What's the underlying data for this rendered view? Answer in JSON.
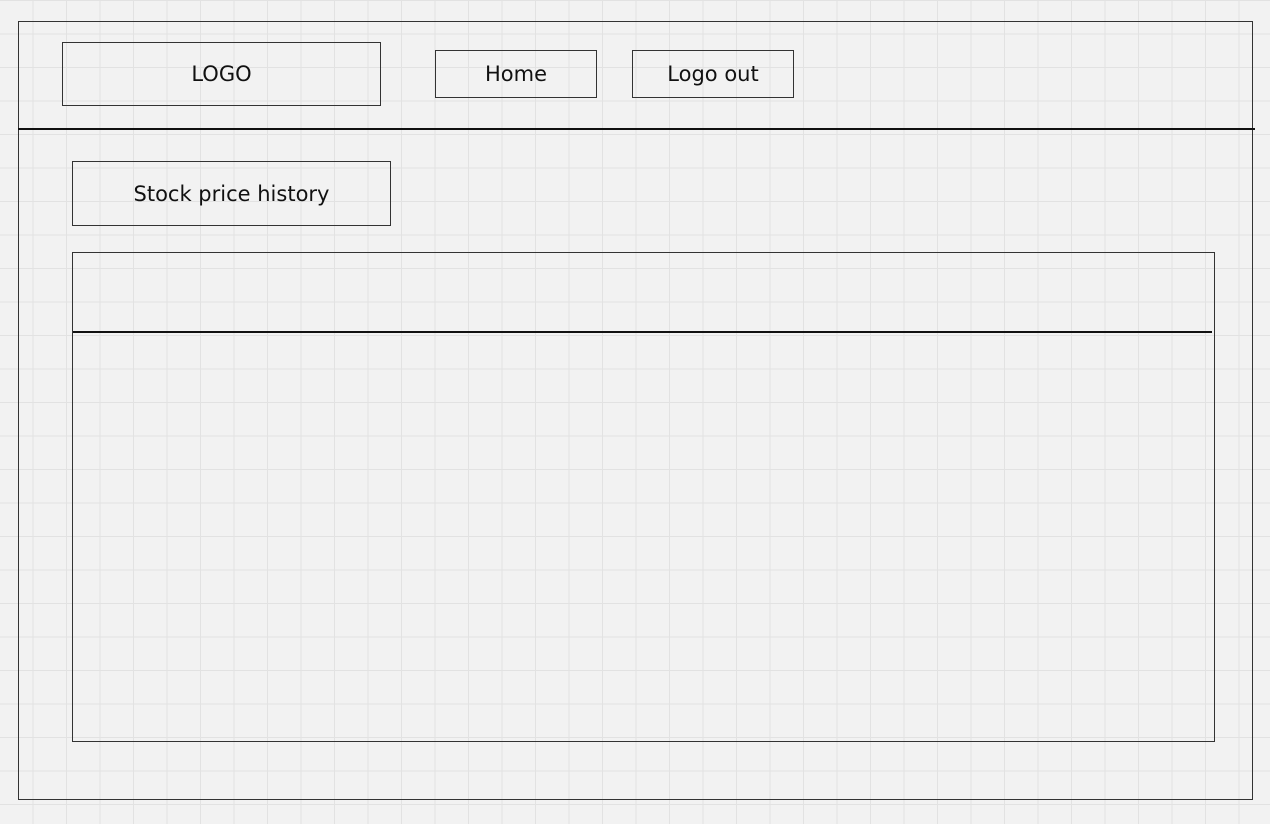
{
  "header": {
    "logo_text": "LOGO",
    "nav": {
      "home_label": "Home",
      "logout_label": "Logo out"
    }
  },
  "main": {
    "section_title": "Stock price history"
  }
}
